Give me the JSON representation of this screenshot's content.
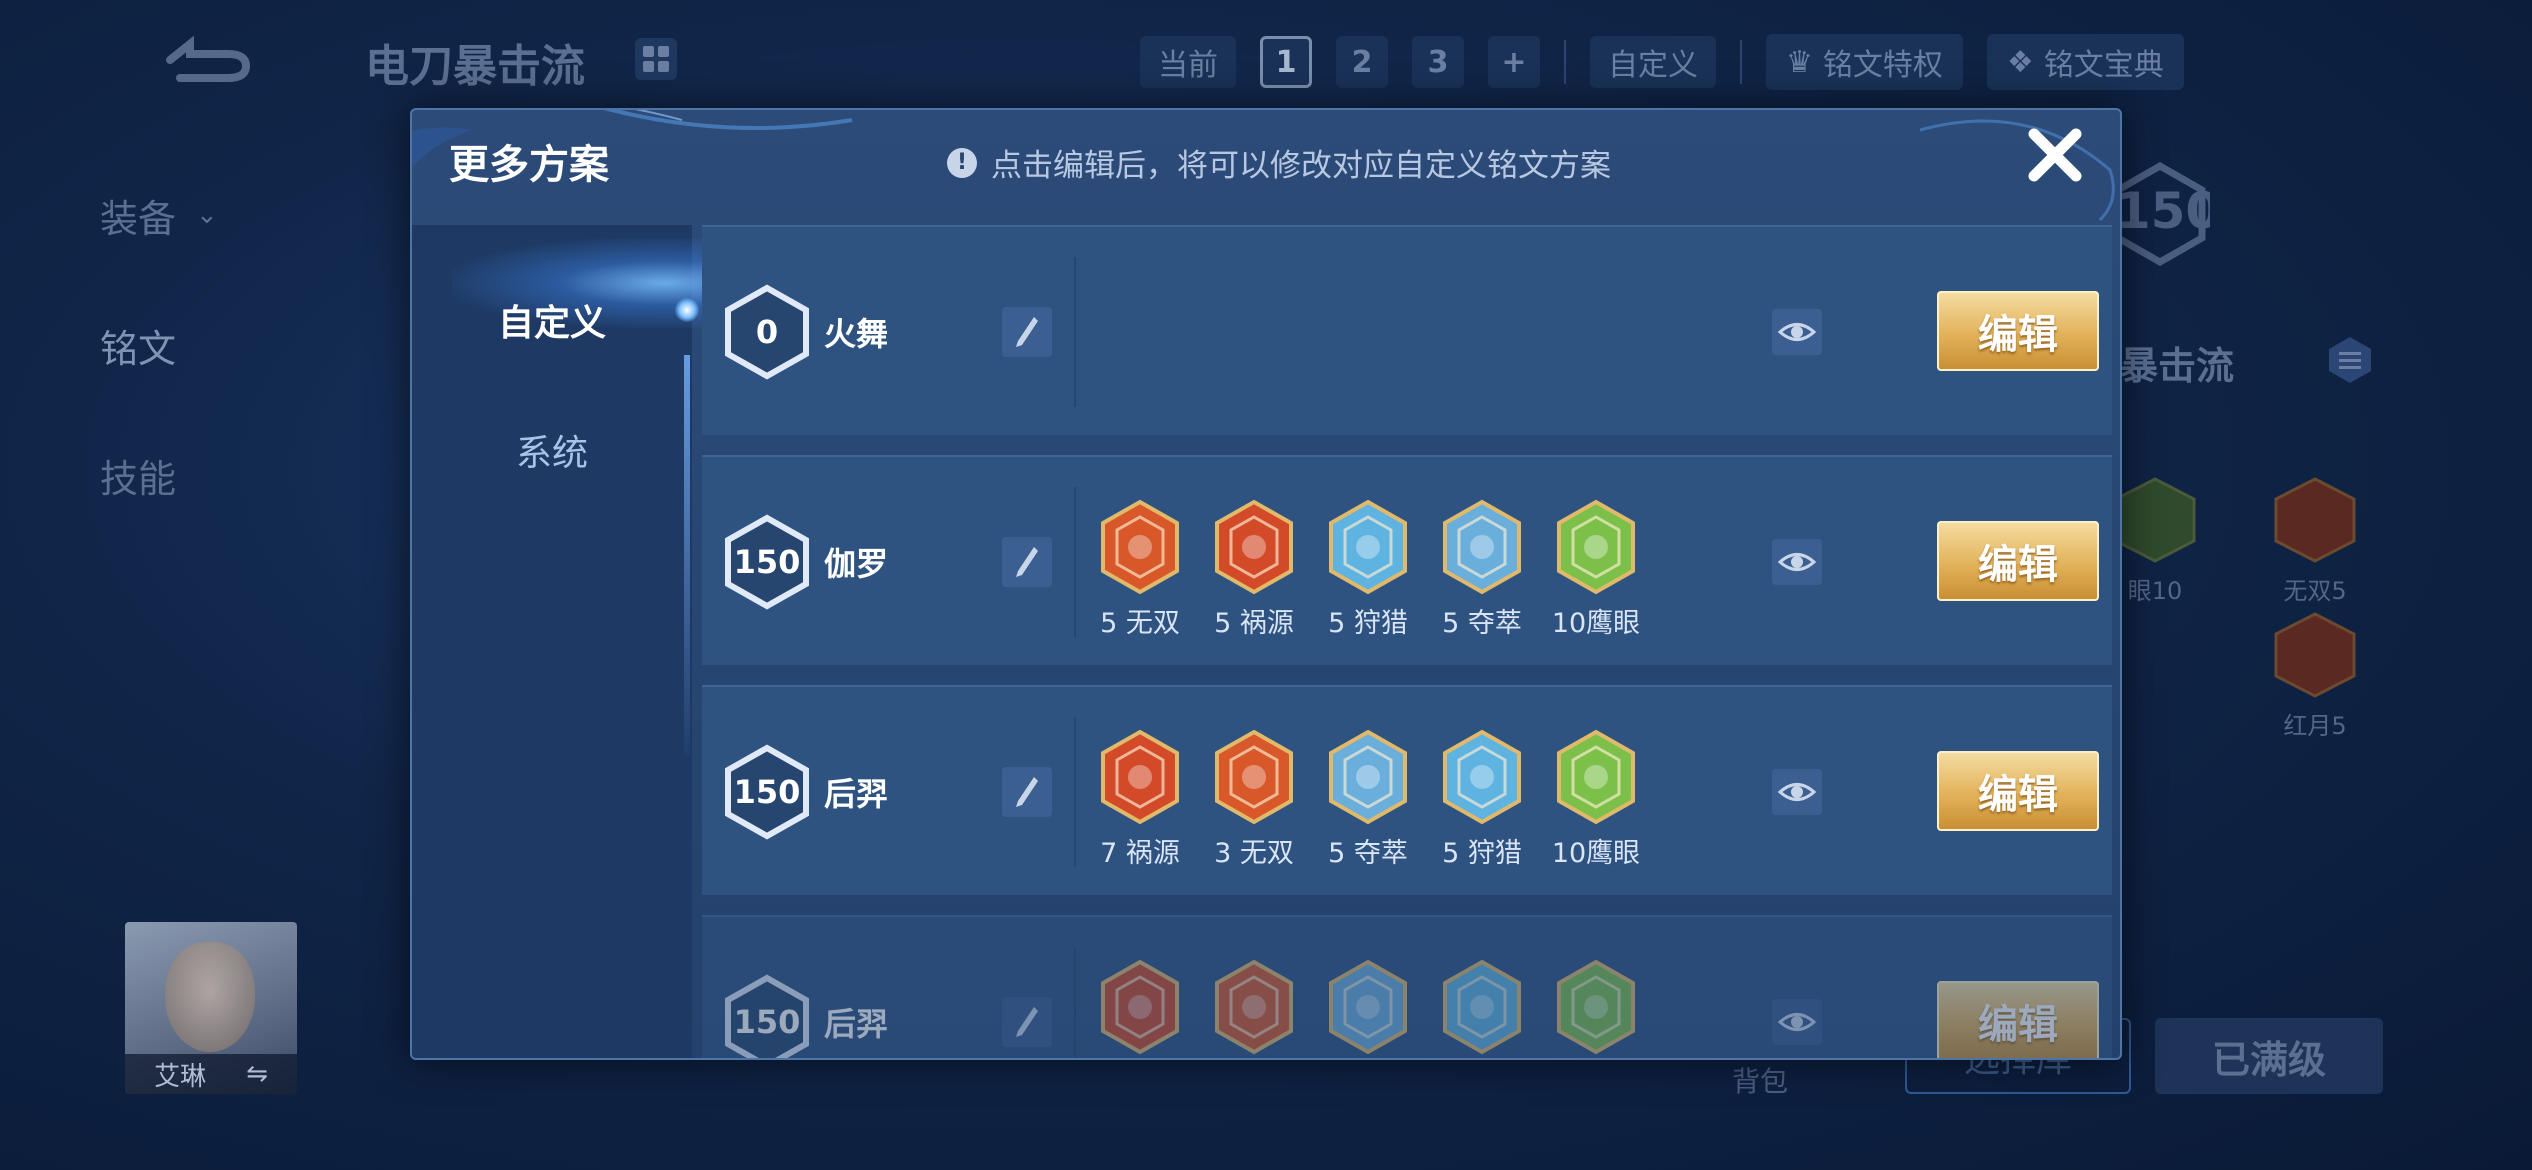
{
  "background": {
    "scheme_title": "电刀暴击流",
    "top_tabs": {
      "current_label": "当前",
      "slots": [
        "1",
        "2",
        "3"
      ],
      "add_label": "+",
      "custom_label": "自定义"
    },
    "privilege_label": "铭文特权",
    "codex_label": "铭文宝典",
    "side_menu": [
      "装备",
      "铭文",
      "技能"
    ],
    "level_badge": "150",
    "scheme_name_partial": "暴击流",
    "runes_preview": [
      {
        "label": "眼10"
      },
      {
        "label": "无双5"
      },
      {
        "label": "红月5"
      }
    ],
    "hero_name": "艾琳",
    "bag_label": "背包",
    "select_btn": "选择库",
    "maxed_btn": "已满级"
  },
  "modal": {
    "title": "更多方案",
    "hint": "点击编辑后，将可以修改对应自定义铭文方案",
    "tabs": [
      {
        "label": "自定义",
        "active": true
      },
      {
        "label": "系统",
        "active": false
      }
    ],
    "edit_label": "编辑",
    "rows": [
      {
        "level": "0",
        "name": "火舞",
        "runes": []
      },
      {
        "level": "150",
        "name": "伽罗",
        "runes": [
          {
            "label": "5 无双",
            "icon": "wushuang-rune-icon",
            "color": "#d8582a"
          },
          {
            "label": "5 祸源",
            "icon": "huoyuan-rune-icon",
            "color": "#d24a28"
          },
          {
            "label": "5 狩猎",
            "icon": "shoulie-rune-icon",
            "color": "#5fb3e0"
          },
          {
            "label": "5 夺萃",
            "icon": "duocui-rune-icon",
            "color": "#6aaedc"
          },
          {
            "label": "10鹰眼",
            "icon": "yingyan-rune-icon",
            "color": "#7cc04a"
          }
        ]
      },
      {
        "level": "150",
        "name": "后羿",
        "runes": [
          {
            "label": "7 祸源",
            "icon": "huoyuan-rune-icon",
            "color": "#d24a28"
          },
          {
            "label": "3 无双",
            "icon": "wushuang-rune-icon",
            "color": "#d8582a"
          },
          {
            "label": "5 夺萃",
            "icon": "duocui-rune-icon",
            "color": "#6aaedc"
          },
          {
            "label": "5 狩猎",
            "icon": "shoulie-rune-icon",
            "color": "#5fb3e0"
          },
          {
            "label": "10鹰眼",
            "icon": "yingyan-rune-icon",
            "color": "#7cc04a"
          }
        ]
      },
      {
        "level": "150",
        "name": "后羿",
        "runes": [
          {
            "label": "",
            "icon": "huoyuan-rune-icon",
            "color": "#d24a28"
          },
          {
            "label": "",
            "icon": "wushuang-rune-icon",
            "color": "#d8582a"
          },
          {
            "label": "",
            "icon": "duocui-rune-icon",
            "color": "#6aaedc"
          },
          {
            "label": "",
            "icon": "shoulie-rune-icon",
            "color": "#5fb3e0"
          },
          {
            "label": "",
            "icon": "yingyan-rune-icon",
            "color": "#7cc04a"
          }
        ]
      }
    ]
  },
  "colors": {
    "gold": "#e2b25a",
    "panel": "#2f5381",
    "bg": "#102548"
  }
}
